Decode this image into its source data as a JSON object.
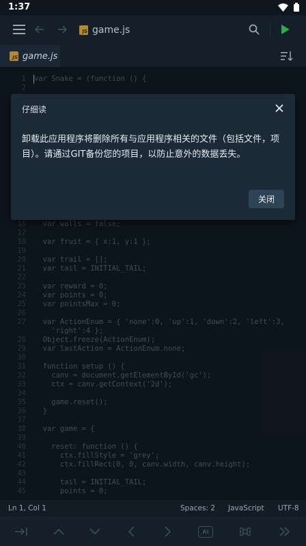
{
  "status_bar": {
    "time": "1:37"
  },
  "toolbar": {
    "file_title": "game.js",
    "js_badge": "JS"
  },
  "tab": {
    "label": "game.js"
  },
  "code_lines": [
    {
      "n": "1",
      "t": "var Snake = (function () {"
    },
    {
      "n": "2",
      "t": ""
    },
    {
      "n": "16",
      "t": "  var walls = false;"
    },
    {
      "n": "17",
      "t": ""
    },
    {
      "n": "18",
      "t": "  var fruit = { x:1, y:1 };"
    },
    {
      "n": "19",
      "t": ""
    },
    {
      "n": "20",
      "t": "  var trail = [];"
    },
    {
      "n": "21",
      "t": "  var tail = INITIAL_TAIL;"
    },
    {
      "n": "22",
      "t": ""
    },
    {
      "n": "23",
      "t": "  var reward = 0;"
    },
    {
      "n": "24",
      "t": "  var points = 0;"
    },
    {
      "n": "25",
      "t": "  var pointsMax = 0;"
    },
    {
      "n": "26",
      "t": ""
    },
    {
      "n": "27",
      "t": "  var ActionEnum = { 'none':0, 'up':1, 'down':2, 'left':3,"
    },
    {
      "n": "",
      "t": "    'right':4 };"
    },
    {
      "n": "28",
      "t": "  Object.freeze(ActionEnum);"
    },
    {
      "n": "29",
      "t": "  var lastAction = ActionEnum.none;"
    },
    {
      "n": "30",
      "t": ""
    },
    {
      "n": "31",
      "t": "  function setup () {"
    },
    {
      "n": "32",
      "t": "    canv = document.getElementById('gc');"
    },
    {
      "n": "33",
      "t": "    ctx = canv.getContext('2d');"
    },
    {
      "n": "34",
      "t": ""
    },
    {
      "n": "35",
      "t": "    game.reset();"
    },
    {
      "n": "36",
      "t": "  }"
    },
    {
      "n": "37",
      "t": ""
    },
    {
      "n": "38",
      "t": "  var game = {"
    },
    {
      "n": "39",
      "t": ""
    },
    {
      "n": "40",
      "t": "    reset: function () {"
    },
    {
      "n": "41",
      "t": "      ctx.fillStyle = 'grey';"
    },
    {
      "n": "42",
      "t": "      ctx.fillRect(0, 0, canv.width, canv.height);"
    },
    {
      "n": "43",
      "t": ""
    },
    {
      "n": "44",
      "t": "      tail = INITIAL_TAIL;"
    },
    {
      "n": "45",
      "t": "      points = 0;"
    }
  ],
  "dialog": {
    "title": "仔细读",
    "message": "卸载此应用程序将删除所有与应用程序相关的文件（包括文件，项目）。请通过GIT备份您的项目，以防止意外的数据丢失。",
    "close_button": "关闭"
  },
  "info_bar": {
    "position": "Ln 1, Col 1",
    "spaces": "Spaces: 2",
    "language": "JavaScript",
    "encoding": "UTF-8"
  },
  "bottom_bar": {
    "ai_label": "AI"
  }
}
